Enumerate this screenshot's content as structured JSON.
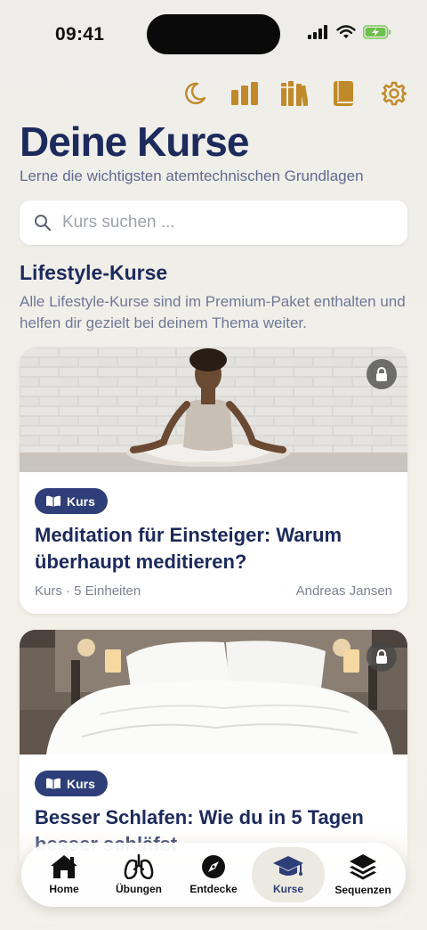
{
  "status": {
    "time": "09:41"
  },
  "toolbar": {
    "icons": [
      "moon-icon",
      "stats-icon",
      "library-icon",
      "book-icon",
      "settings-icon"
    ],
    "accent": "#c08a2a"
  },
  "header": {
    "title": "Deine Kurse",
    "subtitle": "Lerne die wichtigsten atemtechnischen Grundlagen"
  },
  "search": {
    "placeholder": "Kurs suchen ..."
  },
  "section": {
    "title": "Lifestyle-Kurse",
    "description": "Alle Lifestyle-Kurse sind im Premium-Paket enthalten und helfen dir gezielt bei deinem Thema weiter."
  },
  "courses": [
    {
      "badge": "Kurs",
      "title": "Meditation für Einsteiger: Warum überhaupt meditieren?",
      "meta": "Kurs · 5 Einheiten",
      "author": "Andreas Jansen",
      "locked": true
    },
    {
      "badge": "Kurs",
      "title": "Besser Schlafen: Wie du in 5 Tagen besser schläfst",
      "locked": true
    }
  ],
  "tabbar": {
    "items": [
      {
        "label": "Home",
        "icon": "home-icon"
      },
      {
        "label": "Übungen",
        "icon": "lungs-icon"
      },
      {
        "label": "Entdecke",
        "icon": "compass-icon"
      },
      {
        "label": "Kurse",
        "icon": "graduation-cap-icon"
      },
      {
        "label": "Sequenzen",
        "icon": "layers-icon"
      }
    ],
    "active": "Kurse",
    "active_color": "#2e3e79"
  }
}
